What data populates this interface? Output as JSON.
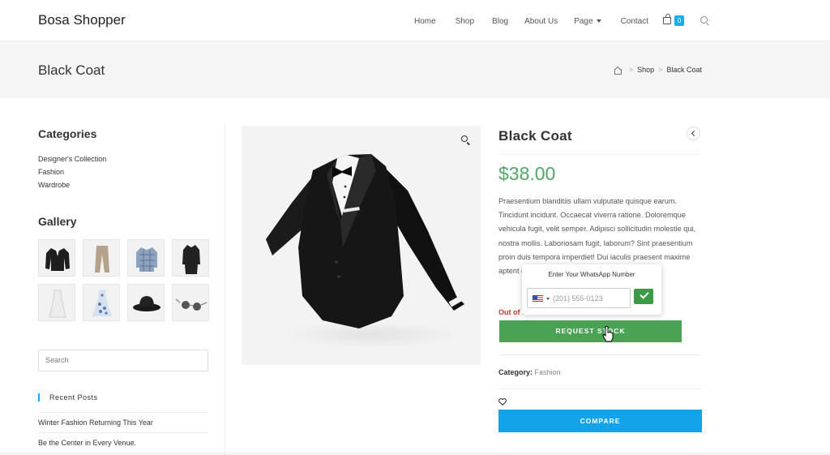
{
  "site": {
    "title": "Bosa Shopper"
  },
  "nav": {
    "home": "Home",
    "shop": "Shop",
    "blog": "Blog",
    "about": "About Us",
    "page": "Page",
    "contact": "Contact",
    "cart_count": "0"
  },
  "page": {
    "title": "Black Coat",
    "breadcrumb": [
      "Shop",
      "Black Coat"
    ]
  },
  "sidebar": {
    "categories_title": "Categories",
    "categories": [
      "Designer's Collection",
      "Fashion",
      "Wardrobe"
    ],
    "gallery_title": "Gallery",
    "gallery": [
      "jacket",
      "trousers",
      "checked-shirt",
      "long-coat",
      "white-dress",
      "floral-dress",
      "hat",
      "sunglasses"
    ],
    "search_placeholder": "Search",
    "recent_posts_title": "Recent Posts",
    "recent_posts": [
      "Winter Fashion Returning This Year",
      "Be the Center in Every Venue."
    ]
  },
  "product": {
    "title": "Black Coat",
    "price": "$38.00",
    "description": "Praesentium blanditiis ullam vulputate quisque earum. Tincidunt incidunt. Occaecat viverra ratione. Doloremque vehicula fugit, velit semper. Adipisci sollicitudin molestie qui, nostra mollis. Laboriosam fugit, laborum? Sint praesentium proin duis tempora imperdiet! Dui iaculis praesent maxime aptent que lacinia quia s",
    "stock_status": "Out of stock",
    "request_stock_label": "REQUEST STOCK",
    "category_label": "Category:",
    "category_value": "Fashion",
    "compare_label": "COMPARE"
  },
  "whatsapp_popup": {
    "title": "Enter Your WhatsApp Number",
    "phone_placeholder": "(201) 555-0123",
    "country": "US"
  },
  "colors": {
    "accent": "#13aff0",
    "price": "#52a668",
    "request_button": "#4aa254",
    "compare_button": "#13a3e8",
    "out_of_stock": "#c0392b"
  }
}
